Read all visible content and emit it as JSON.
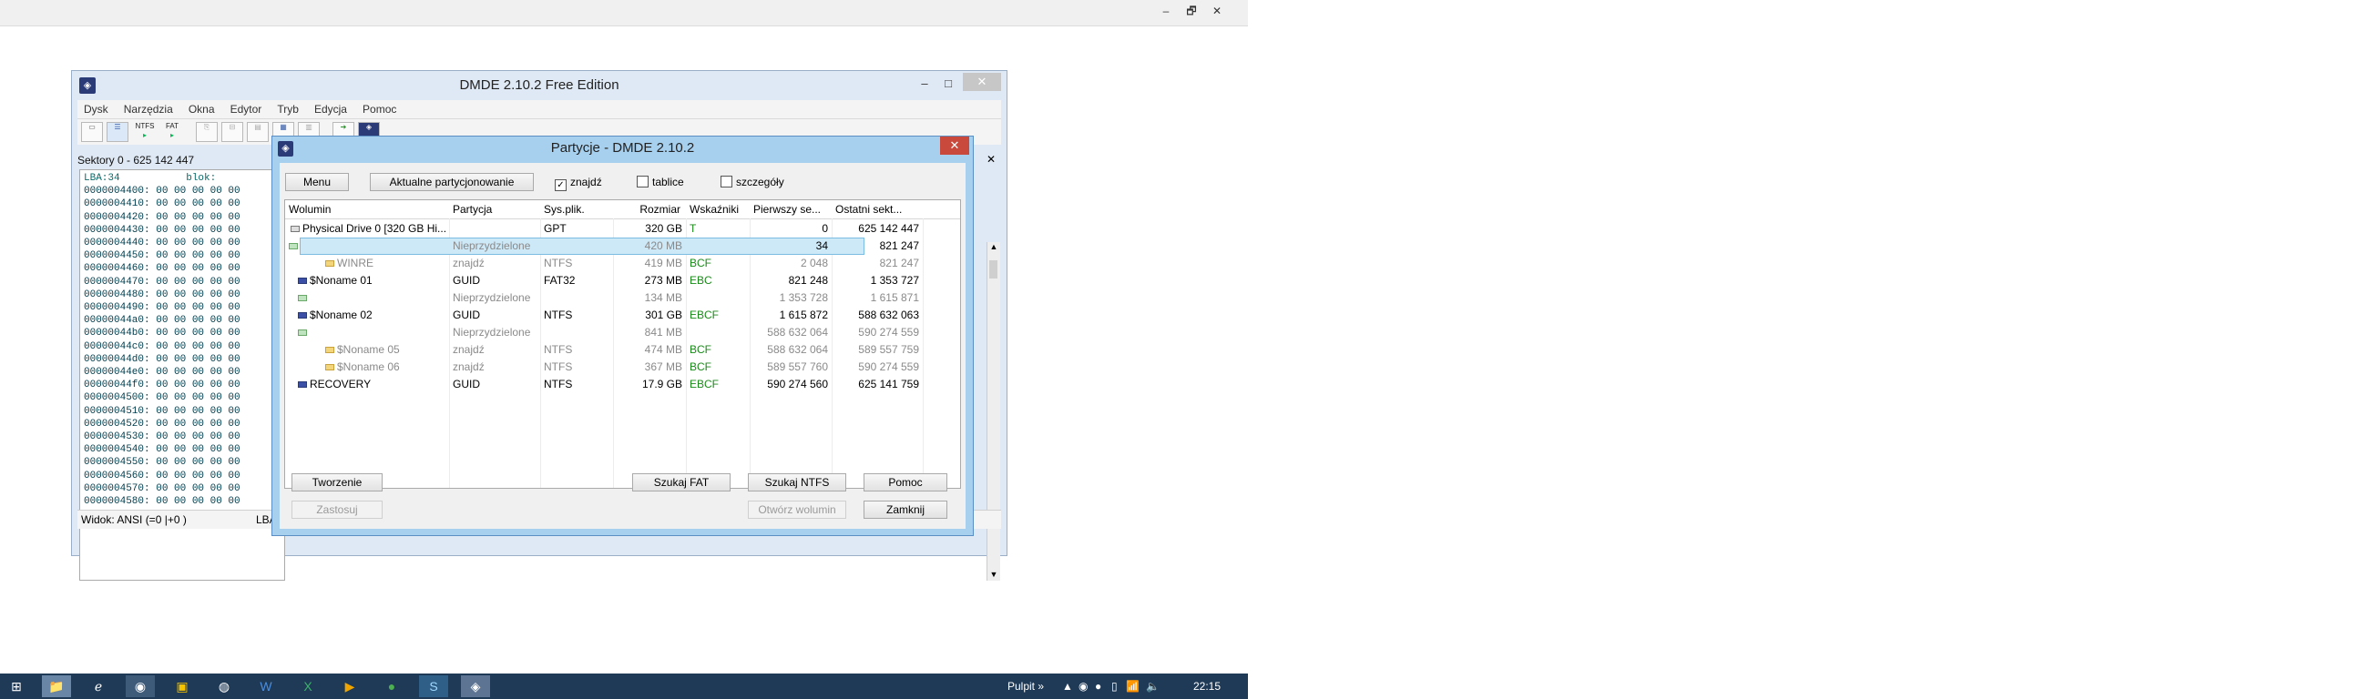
{
  "desktop": {
    "top_controls": [
      "–",
      "🗗",
      "✕"
    ]
  },
  "main_window": {
    "title": "DMDE 2.10.2 Free Edition",
    "controls": {
      "minimize": "–",
      "maximize": "□",
      "close": "✕"
    },
    "menu": [
      "Dysk",
      "Narzędzia",
      "Okna",
      "Edytor",
      "Tryb",
      "Edycja",
      "Pomoc"
    ],
    "toolbar": {
      "ntfs_label": "NTFS",
      "fat_label": "FAT"
    },
    "sectors_label": "Sektory 0 - 625 142 447",
    "hex_header": "LBA:34           blok:",
    "hex_rows": [
      "0000004400: 00 00 00 00 00",
      "0000004410: 00 00 00 00 00",
      "0000004420: 00 00 00 00 00",
      "0000004430: 00 00 00 00 00",
      "0000004440: 00 00 00 00 00",
      "0000004450: 00 00 00 00 00",
      "0000004460: 00 00 00 00 00",
      "0000004470: 00 00 00 00 00",
      "0000004480: 00 00 00 00 00",
      "0000004490: 00 00 00 00 00",
      "00000044a0: 00 00 00 00 00",
      "00000044b0: 00 00 00 00 00",
      "00000044c0: 00 00 00 00 00",
      "00000044d0: 00 00 00 00 00",
      "00000044e0: 00 00 00 00 00",
      "00000044f0: 00 00 00 00 00",
      "0000004500: 00 00 00 00 00",
      "0000004510: 00 00 00 00 00",
      "0000004520: 00 00 00 00 00",
      "0000004530: 00 00 00 00 00",
      "0000004540: 00 00 00 00 00",
      "0000004550: 00 00 00 00 00",
      "0000004560: 00 00 00 00 00",
      "0000004570: 00 00 00 00 00",
      "0000004580: 00 00 00 00 00"
    ],
    "status_left": "Widok: ANSI (=0  |+0 )",
    "status_right": "LBA:"
  },
  "dialog": {
    "title": "Partycje - DMDE 2.10.2",
    "close": "✕",
    "buttons": {
      "menu": "Menu",
      "current": "Aktualne partycjonowanie",
      "create": "Tworzenie",
      "apply": "Zastosuj",
      "search_fat": "Szukaj FAT",
      "search_ntfs": "Szukaj NTFS",
      "open_volume": "Otwórz wolumin",
      "help": "Pomoc",
      "close_btn": "Zamknij"
    },
    "checkboxes": [
      {
        "label": "znajdź",
        "checked": true
      },
      {
        "label": "tablice",
        "checked": false
      },
      {
        "label": "szczegóły",
        "checked": false
      }
    ],
    "columns": [
      "Wolumin",
      "Partycja",
      "Sys.plik.",
      "Rozmiar",
      "Wskaźniki",
      "Pierwszy se...",
      "Ostatni sekt..."
    ],
    "rows": [
      {
        "volume": "Physical Drive 0 [320 GB Hi...",
        "partition": "",
        "fs": "GPT",
        "size": "320 GB",
        "flags": "T",
        "first": "0",
        "last": "625 142 447",
        "style": "normal",
        "indent": 0,
        "icon": "drive-icon",
        "selected": false
      },
      {
        "volume": "",
        "partition": "Nieprzydzielone",
        "fs": "",
        "size": "420 MB",
        "flags": "",
        "first": "34",
        "last": "821 247",
        "style": "gray",
        "indent": 1,
        "icon": "unallocated-icon",
        "selected": true
      },
      {
        "volume": "WINRE",
        "partition": "znajdź",
        "fs": "NTFS",
        "size": "419 MB",
        "flags": "BCF",
        "first": "2 048",
        "last": "821 247",
        "style": "gray",
        "indent": 3,
        "icon": "folder-icon",
        "selected": false
      },
      {
        "volume": "$Noname 01",
        "partition": "GUID",
        "fs": "FAT32",
        "size": "273 MB",
        "flags": "EBC",
        "first": "821 248",
        "last": "1 353 727",
        "style": "normal",
        "indent": 1,
        "icon": "partition-icon",
        "selected": false
      },
      {
        "volume": "",
        "partition": "Nieprzydzielone",
        "fs": "",
        "size": "134 MB",
        "flags": "",
        "first": "1 353 728",
        "last": "1 615 871",
        "style": "gray",
        "indent": 1,
        "icon": "unallocated-icon",
        "selected": false
      },
      {
        "volume": "$Noname 02",
        "partition": "GUID",
        "fs": "NTFS",
        "size": "301 GB",
        "flags": "EBCF",
        "first": "1 615 872",
        "last": "588 632 063",
        "style": "normal",
        "indent": 1,
        "icon": "partition-icon",
        "selected": false
      },
      {
        "volume": "",
        "partition": "Nieprzydzielone",
        "fs": "",
        "size": "841 MB",
        "flags": "",
        "first": "588 632 064",
        "last": "590 274 559",
        "style": "gray",
        "indent": 1,
        "icon": "unallocated-icon",
        "selected": false
      },
      {
        "volume": "$Noname 05",
        "partition": "znajdź",
        "fs": "NTFS",
        "size": "474 MB",
        "flags": "BCF",
        "first": "588 632 064",
        "last": "589 557 759",
        "style": "gray",
        "indent": 3,
        "icon": "folder-icon",
        "selected": false
      },
      {
        "volume": "$Noname 06",
        "partition": "znajdź",
        "fs": "NTFS",
        "size": "367 MB",
        "flags": "BCF",
        "first": "589 557 760",
        "last": "590 274 559",
        "style": "gray",
        "indent": 3,
        "icon": "folder-icon",
        "selected": false
      },
      {
        "volume": "RECOVERY",
        "partition": "GUID",
        "fs": "NTFS",
        "size": "17.9 GB",
        "flags": "EBCF",
        "first": "590 274 560",
        "last": "625 141 759",
        "style": "normal",
        "indent": 1,
        "icon": "partition-icon",
        "selected": false
      }
    ]
  },
  "taskbar": {
    "start_icon": "windows-start-icon",
    "apps": [
      "explorer-icon",
      "ie-icon",
      "chrome-icon",
      "norton-icon",
      "app-icon",
      "word-icon",
      "excel-icon",
      "media-icon",
      "green-app-icon",
      "skype-icon",
      "dmde-icon"
    ],
    "pulpit": "Pulpit",
    "tray_chevron": "»",
    "time": "22:15"
  },
  "colors": {
    "dialog_frame": "#a7d0ef",
    "selection": "#cde8f7",
    "flag_green": "#1a8a1a",
    "taskbar": "#1f3a57",
    "close_red": "#c94a3d"
  }
}
